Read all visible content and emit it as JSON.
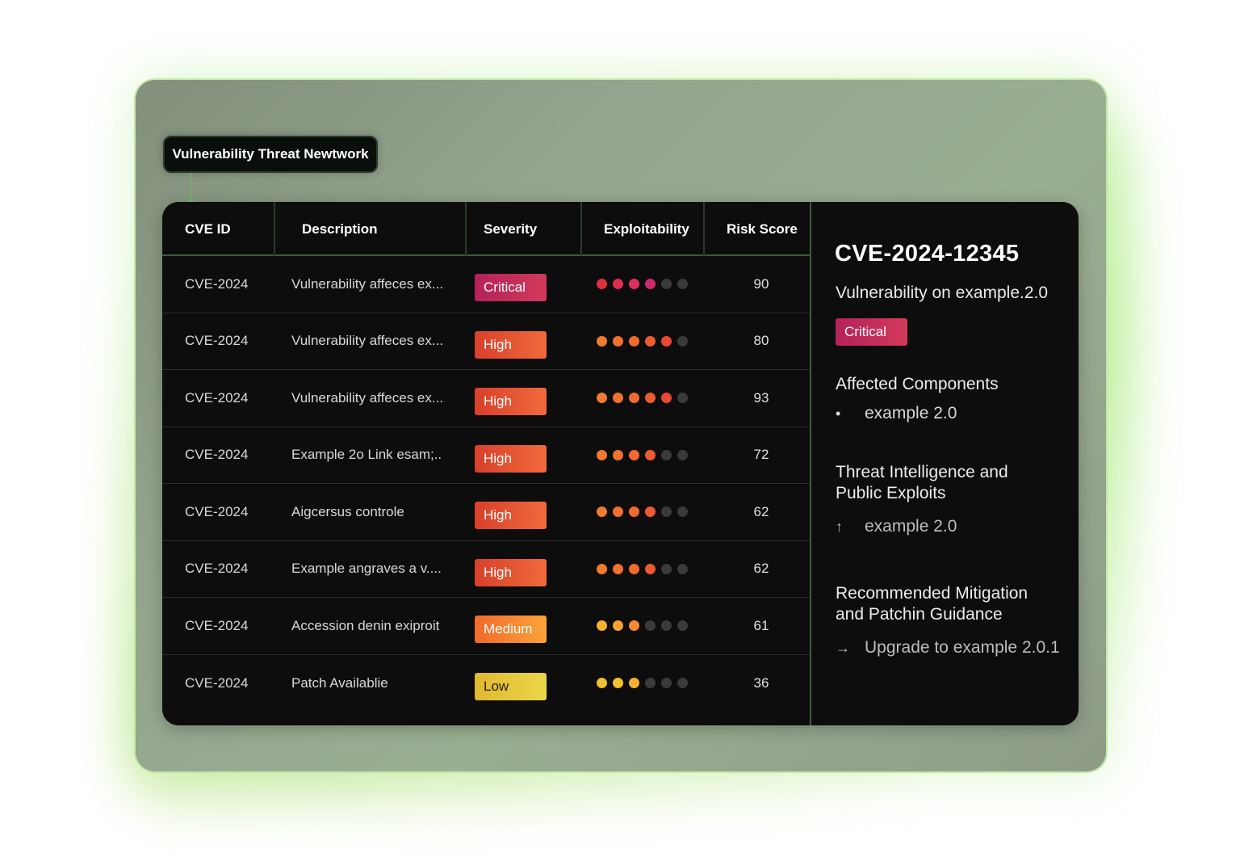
{
  "app": {
    "title": "Vulnerability Threat Newtwork"
  },
  "table": {
    "headers": [
      "CVE ID",
      "Description",
      "Severity",
      "Exploitability",
      "Risk Score"
    ],
    "rows": [
      {
        "id": "CVE-2024",
        "desc": "Vulnerability affeces ex...",
        "severity": "Critical",
        "exploitability": 4,
        "score": "90"
      },
      {
        "id": "CVE-2024",
        "desc": "Vulnerability affeces ex...",
        "severity": "High",
        "exploitability": 5,
        "score": "80"
      },
      {
        "id": "CVE-2024",
        "desc": "Vulnerability affeces ex...",
        "severity": "High",
        "exploitability": 5,
        "score": "93"
      },
      {
        "id": "CVE-2024",
        "desc": "Example 2o Link esam;..",
        "severity": "High",
        "exploitability": 4,
        "score": "72"
      },
      {
        "id": "CVE-2024",
        "desc": "Aigcersus controle",
        "severity": "High",
        "exploitability": 4,
        "score": "62"
      },
      {
        "id": "CVE-2024",
        "desc": "Example angraves a v....",
        "severity": "High",
        "exploitability": 4,
        "score": "62"
      },
      {
        "id": "CVE-2024",
        "desc": "Accession denin exiproit",
        "severity": "Medium",
        "exploitability": 3,
        "score": "61"
      },
      {
        "id": "CVE-2024",
        "desc": "Patch Availablie",
        "severity": "Low",
        "exploitability": 3,
        "score": "36"
      }
    ]
  },
  "detail": {
    "id": "CVE-2024-12345",
    "subtitle": "Vulnerability on example.2.0",
    "severity": "Critical",
    "affected_heading": "Affected Components",
    "affected_item": "example 2.0",
    "affected_marker": "•",
    "threat_heading_line1": "Threat Intelligence and",
    "threat_heading_line2": "Public Exploits",
    "threat_item": "example 2.0",
    "threat_marker": "↑",
    "mitigation_heading_line1": "Recommended Mitigation",
    "mitigation_heading_line2": "and Patchin Guidance",
    "mitigation_item": "Upgrade to example 2.0.1",
    "mitigation_marker": "→"
  },
  "colors": {
    "critical": [
      "#b3225a",
      "#d23a5a"
    ],
    "high": [
      "#d8402c",
      "#f06a3a"
    ],
    "medium": [
      "#f06a2a",
      "#fba23a"
    ],
    "low": [
      "#e0b830",
      "#ead64a"
    ],
    "dot_inactive": "#3a3a3a"
  },
  "dot_palettes": {
    "Critical": [
      "#e03040",
      "#e03050",
      "#e0305a",
      "#d02870"
    ],
    "High": [
      "#f07a30",
      "#f07030",
      "#f06a30",
      "#ec5a30",
      "#e84830"
    ],
    "Medium": [
      "#f8b030",
      "#f8a030",
      "#f88a30"
    ],
    "Low": [
      "#f0c030",
      "#f4c030",
      "#f8b030"
    ]
  }
}
